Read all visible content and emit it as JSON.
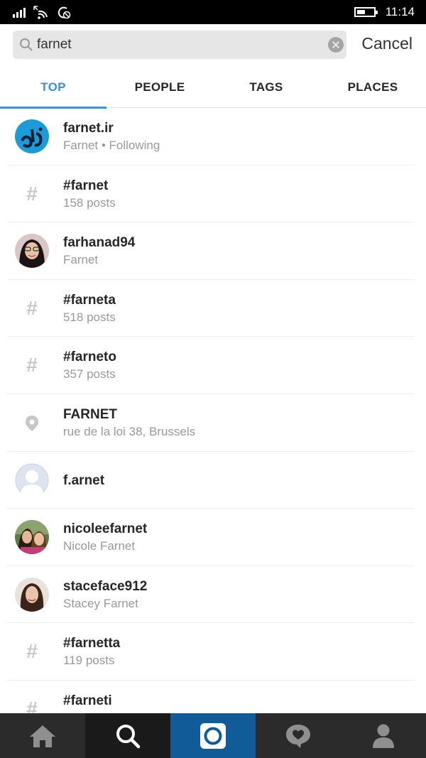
{
  "status_bar": {
    "time": "11:14"
  },
  "search": {
    "value": "farnet",
    "cancel_label": "Cancel"
  },
  "tabs": [
    {
      "label": "TOP",
      "active": true
    },
    {
      "label": "PEOPLE",
      "active": false
    },
    {
      "label": "TAGS",
      "active": false
    },
    {
      "label": "PLACES",
      "active": false
    }
  ],
  "results": [
    {
      "type": "user",
      "icon": "avatar-farnet-logo",
      "title": "farnet.ir",
      "subtitle": "Farnet • Following"
    },
    {
      "type": "tag",
      "icon": "hashtag-icon",
      "title": "#farnet",
      "subtitle": "158 posts"
    },
    {
      "type": "user",
      "icon": "avatar",
      "title": "farhanad94",
      "subtitle": "Farnet"
    },
    {
      "type": "tag",
      "icon": "hashtag-icon",
      "title": "#farneta",
      "subtitle": "518 posts"
    },
    {
      "type": "tag",
      "icon": "hashtag-icon",
      "title": "#farneto",
      "subtitle": "357 posts"
    },
    {
      "type": "place",
      "icon": "location-pin-icon",
      "title": "FARNET",
      "subtitle": "rue de la loi 38, Brussels"
    },
    {
      "type": "user",
      "icon": "default-avatar",
      "title": "f.arnet",
      "subtitle": ""
    },
    {
      "type": "user",
      "icon": "avatar",
      "title": "nicoleefarnet",
      "subtitle": "Nicole Farnet"
    },
    {
      "type": "user",
      "icon": "avatar",
      "title": "staceface912",
      "subtitle": "Stacey Farnet"
    },
    {
      "type": "tag",
      "icon": "hashtag-icon",
      "title": "#farnetta",
      "subtitle": "119 posts"
    },
    {
      "type": "tag",
      "icon": "hashtag-icon",
      "title": "#farneti",
      "subtitle": ""
    }
  ],
  "bottom_nav": [
    {
      "icon": "home-icon"
    },
    {
      "icon": "search-icon"
    },
    {
      "icon": "camera-icon"
    },
    {
      "icon": "activity-heart-icon"
    },
    {
      "icon": "profile-icon"
    }
  ],
  "colors": {
    "accent": "#3d8fd7",
    "camera_tab": "#115b99",
    "nav_bg": "#2b2b2b"
  }
}
